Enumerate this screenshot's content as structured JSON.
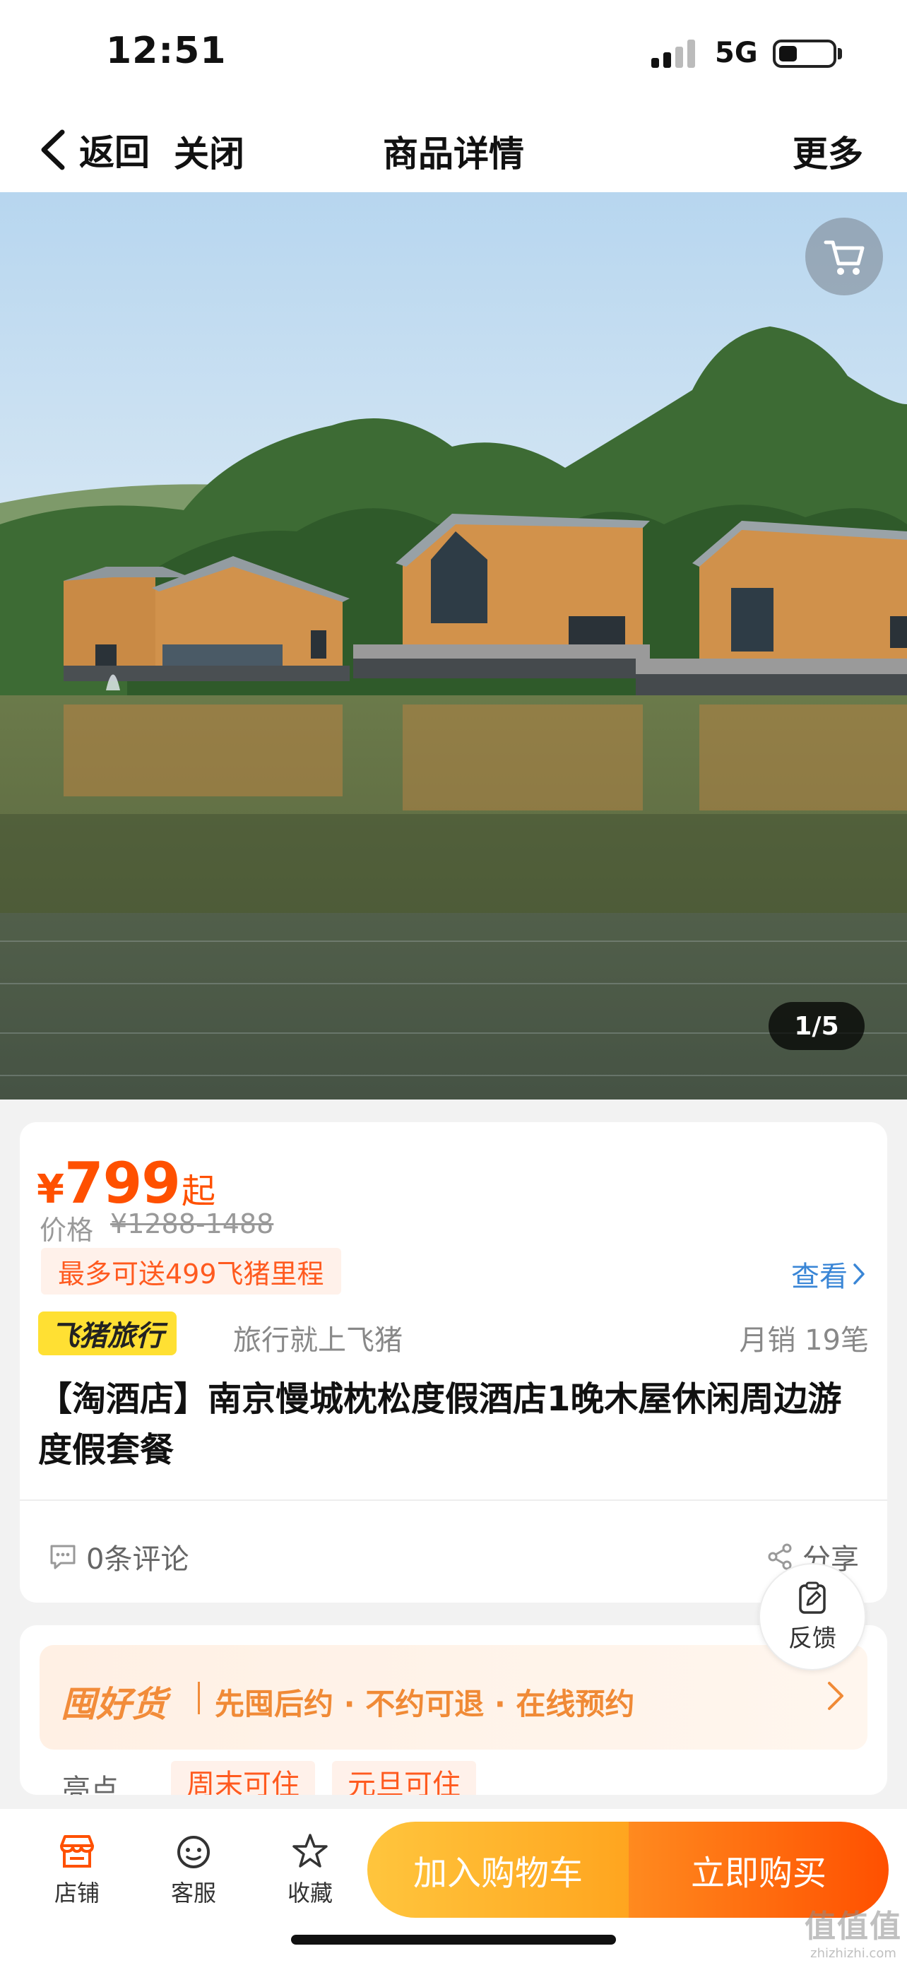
{
  "status_bar": {
    "time": "12:51",
    "network": "5G",
    "battery_level": 0.35
  },
  "nav": {
    "back_label": "返回",
    "close_label": "关闭",
    "title": "商品详情",
    "more_label": "更多"
  },
  "hero": {
    "page_indicator": "1/5",
    "icon": "cart-icon"
  },
  "product": {
    "price_symbol": "¥",
    "price": "799",
    "price_suffix": "起",
    "original_price_label": "价格",
    "original_price": "¥1288-1488",
    "miles_tag": "最多可送499飞猪里程",
    "view_link": "查看",
    "brand_badge": "飞猪旅行",
    "brand_slogan": "旅行就上飞猪",
    "monthly_sales": "月销 19笔",
    "title": "【淘酒店】南京慢城枕松度假酒店1晚木屋休闲周边游度假套餐",
    "comments": "0条评论",
    "share": "分享"
  },
  "feedback": {
    "label": "反馈"
  },
  "promo": {
    "logo": "囤好货",
    "text": "先囤后约 · 不约可退 · 在线预约",
    "highlight_label": "亮点",
    "highlights": [
      "周末可住",
      "元旦可住"
    ]
  },
  "bottom_bar": {
    "tabs": [
      {
        "label": "店铺",
        "icon": "shop-icon"
      },
      {
        "label": "客服",
        "icon": "service-icon"
      },
      {
        "label": "收藏",
        "icon": "star-icon"
      }
    ],
    "add_to_cart": "加入购物车",
    "buy_now": "立即购买"
  },
  "watermark": {
    "main": "值值值",
    "sub": "zhizhizhi.com"
  },
  "colors": {
    "accent": "#ff5000",
    "link": "#3a86d6",
    "brand_yellow": "#ffe033",
    "promo_orange": "#f08a36"
  }
}
